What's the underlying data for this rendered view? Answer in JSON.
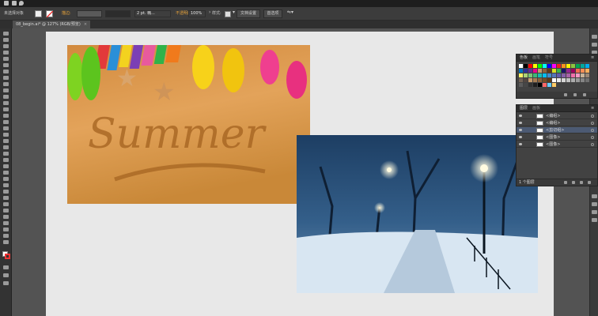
{
  "topbar": {
    "icons": [
      "folder-icon",
      "print-icon",
      "location-pin-icon"
    ]
  },
  "control_bar": {
    "selection_status": "未选择对象",
    "stroke_label": "描边:",
    "stroke_weight": "2 pt. 椭...",
    "opacity_label": "不透明度:",
    "opacity_value": "100%",
    "style_label": "样式:",
    "doc_setup_button": "文档设置",
    "preferences_button": "首选项",
    "accent_colors": {
      "label_orange": "#e8a33a",
      "stroke_swatch": "#ffffff"
    }
  },
  "document_tab": {
    "title": "08_begin.ai* @ 127% (RGB/预览)",
    "close": "×"
  },
  "images": {
    "summer": {
      "sand_text": "Summer"
    },
    "winter": {}
  },
  "swatches_panel": {
    "tabs": [
      "色板",
      "画笔",
      "符号"
    ],
    "colors": [
      "#ffffff",
      "#000000",
      "#ff0000",
      "#ffff00",
      "#00ff00",
      "#00ffff",
      "#0000ff",
      "#ff00ff",
      "#ed1c24",
      "#f7941d",
      "#fff200",
      "#8dc63f",
      "#00a651",
      "#00a99d",
      "#00aeef",
      "#0072bc",
      "#2e3192",
      "#662d91",
      "#ec008c",
      "#c69c6d",
      "#8c6239",
      "#603813",
      "#d7df23",
      "#39b54a",
      "#1b1464",
      "#92278f",
      "#9e005d",
      "#f26c4f",
      "#f68e56",
      "#fbaf5d",
      "#fff568",
      "#acd373",
      "#7cc576",
      "#3bb878",
      "#1abbb4",
      "#00bff3",
      "#438ccb",
      "#5574b9",
      "#605ca8",
      "#855fa8",
      "#a763a8",
      "#f06eaa",
      "#f49ac2",
      "#c7b299",
      "#998675",
      "#736357",
      "#534741",
      "#c69c6d",
      "#a67c52",
      "#8c6239",
      "#754c24",
      "#603913",
      "#ffffff",
      "#ebebeb",
      "#d6d6d6",
      "#c2c2c2",
      "#adadad",
      "#999999",
      "#858585",
      "#707070",
      "#5c5c5c",
      "#474747",
      "#333333",
      "#1f1f1f",
      "#000000",
      "#ff6666",
      "#66ccff",
      "#ffcc66"
    ]
  },
  "layers_panel": {
    "tabs": [
      "图层",
      "画板"
    ],
    "rows": [
      {
        "name": "<编组>",
        "selected": false
      },
      {
        "name": "<编组>",
        "selected": false
      },
      {
        "name": "<剪切组>",
        "selected": true
      },
      {
        "name": "<图像>",
        "selected": false
      },
      {
        "name": "<图像>",
        "selected": false
      }
    ],
    "footer": "1 个图层"
  }
}
